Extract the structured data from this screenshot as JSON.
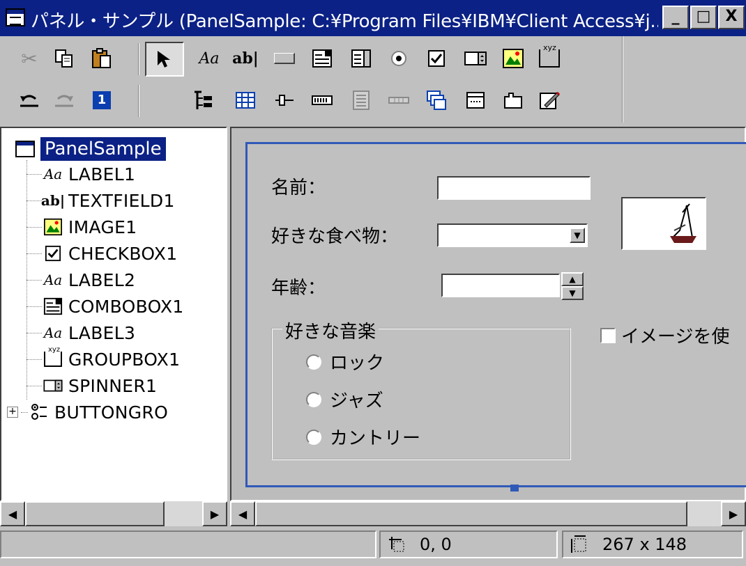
{
  "window": {
    "title": "パネル・サンプル (PanelSample: C:¥Program Files¥IBM¥Client Access¥j...",
    "minimize_glyph": "_",
    "maximize_glyph": "□",
    "close_glyph": "X"
  },
  "toolbar": {
    "row1": [
      {
        "name": "cut",
        "icon": "scissors"
      },
      {
        "name": "copy",
        "icon": "copy"
      },
      {
        "name": "paste",
        "icon": "clipboard"
      },
      {
        "name": "pointer",
        "icon": "arrow-pointer"
      },
      {
        "name": "label-tool",
        "icon": "label",
        "glyph": "Aa"
      },
      {
        "name": "textfield-tool",
        "icon": "textfield",
        "glyph": "ab|"
      },
      {
        "name": "button-tool",
        "icon": "button"
      },
      {
        "name": "combobox-tool",
        "icon": "combobox"
      },
      {
        "name": "listbox-tool",
        "icon": "listbox"
      },
      {
        "name": "radio-tool",
        "icon": "radio"
      },
      {
        "name": "checkbox-tool",
        "icon": "checkbox"
      },
      {
        "name": "spinner-tool",
        "icon": "spinner"
      },
      {
        "name": "image-tool",
        "icon": "image"
      },
      {
        "name": "groupbox-tool",
        "icon": "groupbox",
        "glyph": "xyz"
      }
    ],
    "row2": [
      {
        "name": "undo",
        "icon": "undo"
      },
      {
        "name": "redo",
        "icon": "redo"
      },
      {
        "name": "tab-order",
        "icon": "tab-order",
        "glyph": "1"
      },
      {
        "name": "tree-tool",
        "icon": "tree"
      },
      {
        "name": "table-tool",
        "icon": "table"
      },
      {
        "name": "slider-tool",
        "icon": "slider"
      },
      {
        "name": "progress-tool",
        "icon": "progress"
      },
      {
        "name": "form-tool",
        "icon": "form"
      },
      {
        "name": "line-tool",
        "icon": "line"
      },
      {
        "name": "deck-tool",
        "icon": "deck"
      },
      {
        "name": "menu-tool",
        "icon": "menu"
      },
      {
        "name": "tabbed-tool",
        "icon": "tabbed"
      },
      {
        "name": "edit-tool",
        "icon": "edit"
      }
    ]
  },
  "tree": {
    "root": "PanelSample",
    "items": [
      {
        "label": "LABEL1",
        "icon": "label-icon",
        "glyph": "Aa"
      },
      {
        "label": "TEXTFIELD1",
        "icon": "textfield-icon",
        "glyph": "ab|"
      },
      {
        "label": "IMAGE1",
        "icon": "image-icon",
        "glyph": ""
      },
      {
        "label": "CHECKBOX1",
        "icon": "checkbox-icon",
        "glyph": "✓"
      },
      {
        "label": "LABEL2",
        "icon": "label-icon",
        "glyph": "Aa"
      },
      {
        "label": "COMBOBOX1",
        "icon": "combobox-icon",
        "glyph": ""
      },
      {
        "label": "LABEL3",
        "icon": "label-icon",
        "glyph": "Aa"
      },
      {
        "label": "GROUPBOX1",
        "icon": "groupbox-icon",
        "glyph": "xyz"
      },
      {
        "label": "SPINNER1",
        "icon": "spinner-icon",
        "glyph": ""
      },
      {
        "label": "BUTTONGRO",
        "icon": "buttongroup-icon",
        "glyph": "⁝"
      }
    ],
    "expand_glyph": "+"
  },
  "panel": {
    "name_label": "名前：",
    "food_label": "好きな食べ物：",
    "age_label": "年齢：",
    "music_group_title": "好きな音楽",
    "radios": [
      "ロック",
      "ジャズ",
      "カントリー"
    ],
    "checkbox_label": "イメージを使",
    "name_value": "",
    "food_value": "",
    "age_value": ""
  },
  "status": {
    "position": "0, 0",
    "size": "267 x 148"
  }
}
